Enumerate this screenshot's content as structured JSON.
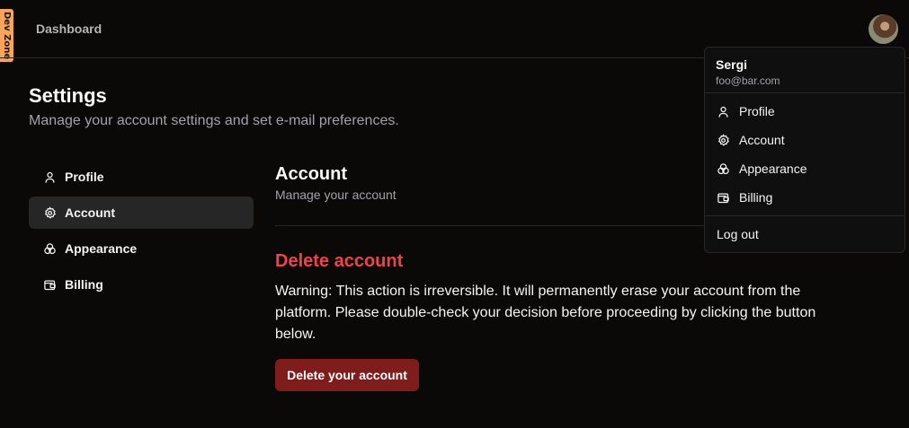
{
  "dev_zone": {
    "label": "Dev Zone"
  },
  "topbar": {
    "nav_link": "Dashboard"
  },
  "page": {
    "title": "Settings",
    "subtitle": "Manage your account settings and set e-mail preferences."
  },
  "sidebar": {
    "items": [
      {
        "label": "Profile",
        "icon": "user-icon"
      },
      {
        "label": "Account",
        "icon": "gear-icon",
        "active": true
      },
      {
        "label": "Appearance",
        "icon": "palette-icon"
      },
      {
        "label": "Billing",
        "icon": "wallet-icon"
      }
    ]
  },
  "section": {
    "title": "Account",
    "subtitle": "Manage your account"
  },
  "danger": {
    "title": "Delete account",
    "warning": "Warning: This action is irreversible. It will permanently erase your account from the platform. Please double-check your decision before proceeding by clicking the button below.",
    "button_label": "Delete your account"
  },
  "user_menu": {
    "name": "Sergi",
    "email": "foo@bar.com",
    "items": [
      {
        "label": "Profile",
        "icon": "user-icon"
      },
      {
        "label": "Account",
        "icon": "gear-icon"
      },
      {
        "label": "Appearance",
        "icon": "palette-icon"
      },
      {
        "label": "Billing",
        "icon": "wallet-icon"
      }
    ],
    "logout_label": "Log out"
  },
  "colors": {
    "background": "#0a0908",
    "danger_text": "#ef4444",
    "danger_button": "#7f1d1d",
    "dev_zone_badge": "#f6a55b",
    "active_nav": "#262626"
  }
}
